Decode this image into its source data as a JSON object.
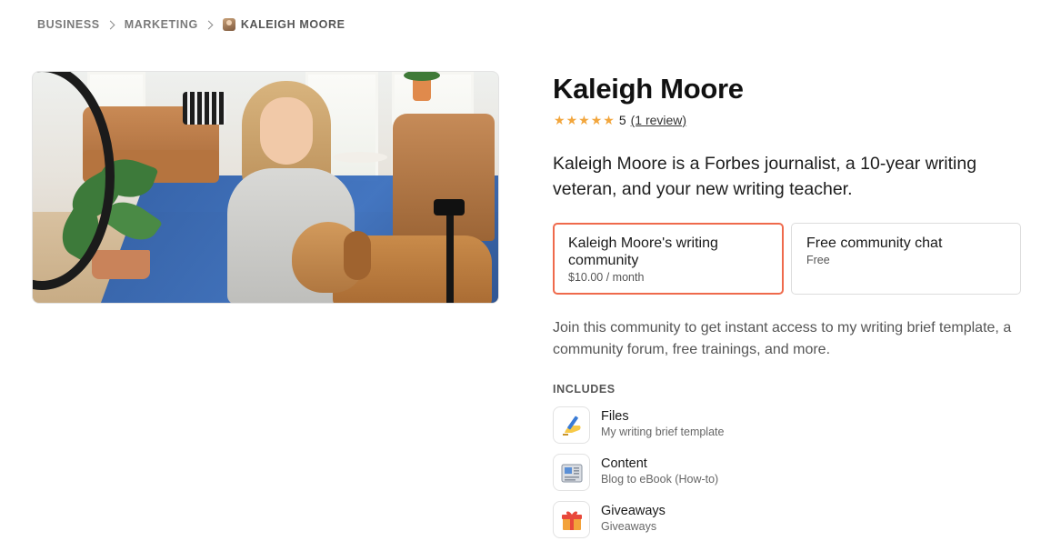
{
  "breadcrumb": {
    "items": [
      "BUSINESS",
      "MARKETING"
    ],
    "current": "KALEIGH MOORE"
  },
  "profile": {
    "name": "Kaleigh Moore",
    "rating": {
      "stars": 5,
      "value": "5",
      "reviews_label": "(1 review)"
    },
    "tagline": "Kaleigh Moore is a Forbes journalist, a 10-year writing veteran, and your new writing teacher."
  },
  "plans": [
    {
      "name": "Kaleigh Moore's writing community",
      "price": "$10.00 / month",
      "selected": true
    },
    {
      "name": "Free community chat",
      "price": "Free",
      "selected": false
    }
  ],
  "description": "Join this community to get instant access to my writing brief template, a community forum, free trainings, and more.",
  "includes": {
    "heading": "INCLUDES",
    "items": [
      {
        "title": "Files",
        "subtitle": "My writing brief template",
        "icon": "writing-hand-icon"
      },
      {
        "title": "Content",
        "subtitle": "Blog to eBook (How-to)",
        "icon": "newspaper-icon"
      },
      {
        "title": "Giveaways",
        "subtitle": "Giveaways",
        "icon": "gift-icon"
      }
    ]
  },
  "colors": {
    "accent_border": "#ef6a4c",
    "star": "#f2a63d"
  }
}
